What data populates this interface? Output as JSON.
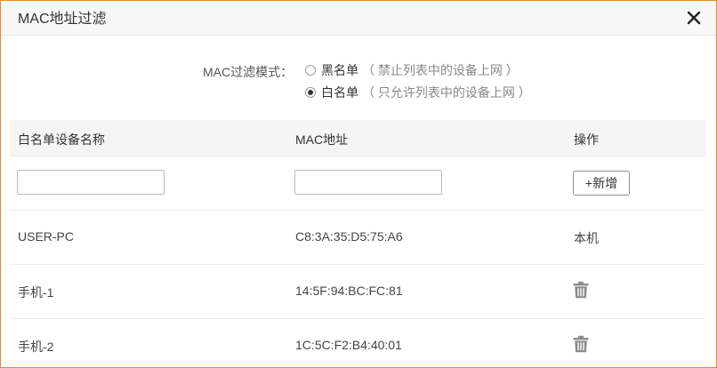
{
  "dialog": {
    "title": "MAC地址过滤"
  },
  "mode": {
    "label": "MAC过滤模式：",
    "options": [
      {
        "name": "黑名单",
        "hint": "（ 禁止列表中的设备上网 ）",
        "checked": false
      },
      {
        "name": "白名单",
        "hint": "（ 只允许列表中的设备上网 ）",
        "checked": true
      }
    ]
  },
  "table": {
    "headers": {
      "name": "白名单设备名称",
      "mac": "MAC地址",
      "action": "操作"
    },
    "new_row": {
      "name_value": "",
      "mac_value": "",
      "add_label": "+新增"
    },
    "rows": [
      {
        "name": "USER-PC",
        "mac": "C8:3A:35:D5:75:A6",
        "action": "本机",
        "action_icon": null
      },
      {
        "name": "手机-1",
        "mac": "14:5F:94:BC:FC:81",
        "action": "",
        "action_icon": "trash-icon"
      },
      {
        "name": "手机-2",
        "mac": "1C:5C:F2:B4:40:01",
        "action": "",
        "action_icon": "trash-icon"
      }
    ]
  },
  "colors": {
    "border_accent": "#e08a3c",
    "icon_gray": "#8a8a8a"
  }
}
